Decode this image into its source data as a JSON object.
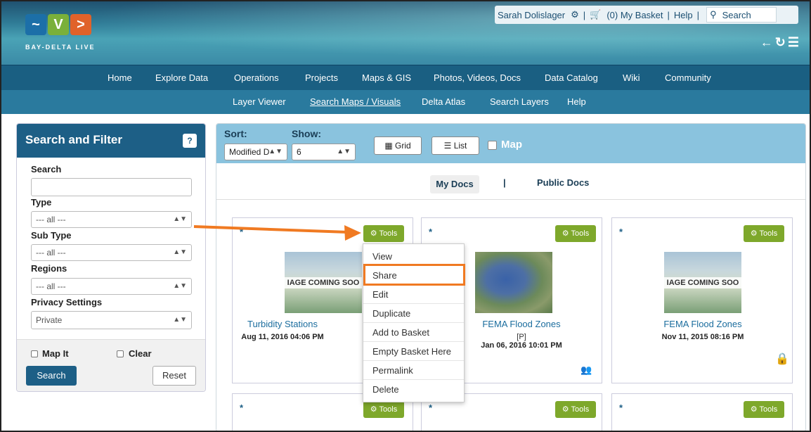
{
  "header": {
    "logo_text": "BAY-DELTA LIVE",
    "user_name": "Sarah Dolislager",
    "basket": "(0) My Basket",
    "help": "Help",
    "search_placeholder": "Search"
  },
  "nav_primary": [
    "Home",
    "Explore Data",
    "Operations",
    "Projects",
    "Maps & GIS",
    "Photos, Videos, Docs",
    "Data Catalog",
    "Wiki",
    "Community"
  ],
  "nav_secondary": [
    "Layer Viewer",
    "Search Maps / Visuals",
    "Delta Atlas",
    "Search Layers",
    "Help"
  ],
  "filter": {
    "title": "Search and Filter",
    "help_button": "?",
    "search_label": "Search",
    "type_label": "Type",
    "type_value": "--- all ---",
    "subtype_label": "Sub Type",
    "subtype_value": "--- all ---",
    "regions_label": "Regions",
    "regions_value": "--- all ---",
    "privacy_label": "Privacy Settings",
    "privacy_value": "Private",
    "map_it": "Map It",
    "clear": "Clear",
    "search_button": "Search",
    "reset_button": "Reset"
  },
  "toolbar": {
    "sort_label": "Sort:",
    "sort_value": "Modified D",
    "show_label": "Show:",
    "show_value": "6",
    "grid": "Grid",
    "list": "List",
    "map": "Map"
  },
  "docs_tabs": {
    "my_docs": "My Docs",
    "separator": "|",
    "public_docs": "Public Docs"
  },
  "cards": [
    {
      "star": "*",
      "tools": "Tools",
      "thumb_text": "IAGE COMING SOO",
      "title": "Turbidity Stations",
      "date": "Aug 11, 2016 04:06 PM"
    },
    {
      "star": "*",
      "tools": "Tools",
      "title": "FEMA Flood Zones",
      "sub": "[P]",
      "date": "Jan 06, 2016 10:01 PM"
    },
    {
      "star": "*",
      "tools": "Tools",
      "thumb_text": "IAGE COMING SOO",
      "title": "FEMA Flood Zones",
      "date": "Nov 11, 2015 08:16 PM"
    },
    {
      "star": "*",
      "tools": "Tools"
    },
    {
      "star": "*",
      "tools": "Tools"
    },
    {
      "star": "*",
      "tools": "Tools"
    }
  ],
  "tools_menu": [
    "View",
    "Share",
    "Edit",
    "Duplicate",
    "Add to Basket",
    "Empty Basket Here",
    "Permalink",
    "Delete"
  ],
  "colors": {
    "nav_dark": "#1a5f82",
    "tools_green": "#7ea82b",
    "highlight_orange": "#f07a22",
    "link_blue": "#1b6d9e"
  }
}
